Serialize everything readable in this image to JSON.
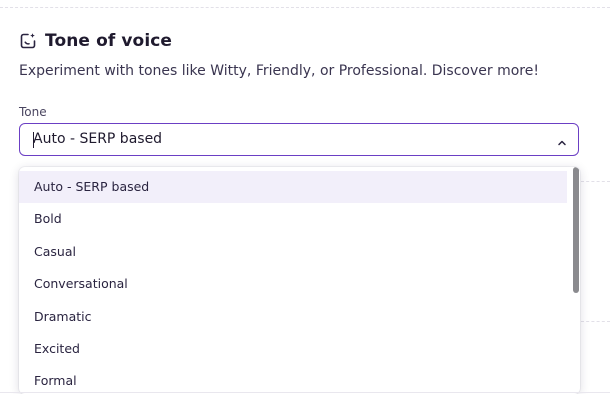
{
  "section": {
    "title": "Tone of voice",
    "description": "Experiment with tones like Witty, Friendly, or Professional. Discover more!",
    "icon": "sparkle-edit-icon"
  },
  "tone_field": {
    "label": "Tone",
    "value": "Auto - SERP based",
    "border_color": "#6b3fc4"
  },
  "dropdown": {
    "options": [
      "Auto - SERP based",
      "Bold",
      "Casual",
      "Conversational",
      "Dramatic",
      "Excited",
      "Formal"
    ],
    "selected": "Auto - SERP based",
    "highlight_color": "#f2effa"
  }
}
